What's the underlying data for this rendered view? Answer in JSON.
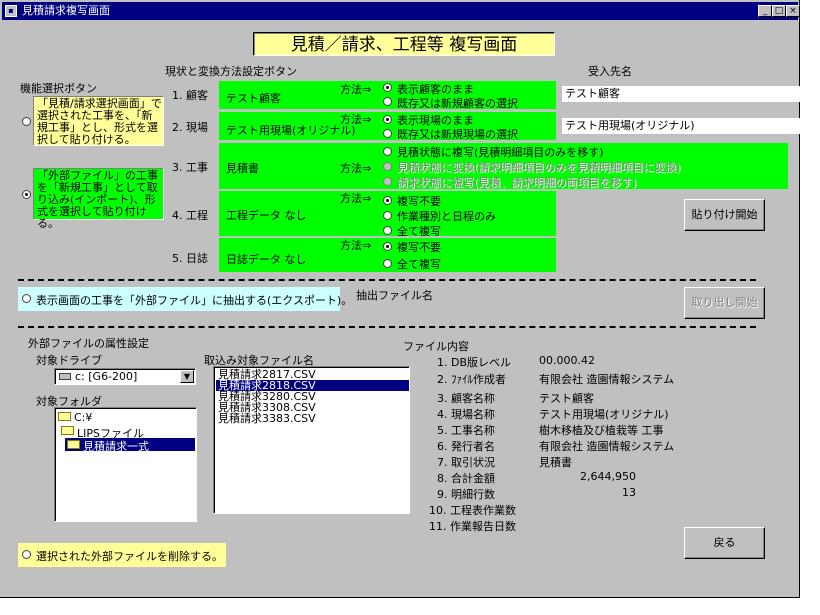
{
  "window": {
    "title": "見積請求複写画面"
  },
  "heading": "見積／請求、工程等 複写画面",
  "section_labels": {
    "function_select": "機能選択ボタン",
    "method_setting": "現状と変換方法設定ボタン",
    "receiver": "受入先名",
    "extract_file": "抽出ファイル名",
    "external_attrs": "外部ファイルの属性設定",
    "target_drive": "対象ドライブ",
    "target_folder": "対象フォルダ",
    "import_files": "取込み対象ファイル名",
    "file_content": "ファイル内容"
  },
  "function_options": [
    {
      "text": "「見積/請求選択画面」で選択された工事を、「新規工事」とし、形式を選択して貼り付ける。",
      "selected": false
    },
    {
      "text": "「外部ファイル」の工事を「新規工事」として取り込み(インポート)、形式を選択して貼り付ける。",
      "selected": true
    }
  ],
  "export_option": "表示画面の工事を「外部ファイル」に抽出する(エクスポート)。",
  "delete_option": "選択された外部ファイルを削除する。",
  "method_label": "方法⇒",
  "rows": [
    {
      "label": "1. 顧客",
      "current": "テスト顧客",
      "options": [
        {
          "text": "表示顧客のまま",
          "selected": true
        },
        {
          "text": "既存又は新規顧客の選択",
          "selected": false
        }
      ],
      "receiver": "テスト顧客"
    },
    {
      "label": "2. 現場",
      "current": "テスト用現場(オリジナル)",
      "options": [
        {
          "text": "表示現場のまま",
          "selected": true
        },
        {
          "text": "既存又は新規現場の選択",
          "selected": false
        }
      ],
      "receiver": "テスト用現場(オリジナル)"
    },
    {
      "label": "3. 工事",
      "current": "見積書",
      "options": [
        {
          "text": "見積状態に複写(見積明細項目のみを移す)",
          "selected": false
        },
        {
          "text": "見積状態に変換(請求明細項目のみを見積明細項目に変換)",
          "selected": false
        },
        {
          "text": "請求状態に複写(見積、請求明細の両項目を移す)",
          "selected": false
        }
      ]
    },
    {
      "label": "4. 工程",
      "current": "工程データ なし",
      "options": [
        {
          "text": "複写不要",
          "selected": true
        },
        {
          "text": "作業種別と日程のみ",
          "selected": false
        },
        {
          "text": "全て複写",
          "selected": false
        }
      ]
    },
    {
      "label": "5. 日誌",
      "current": "日誌データ なし",
      "options": [
        {
          "text": "複写不要",
          "selected": true
        },
        {
          "text": "全て複写",
          "selected": false
        }
      ]
    }
  ],
  "buttons": {
    "paste": "貼り付け開始",
    "extract": "取り出し開始",
    "back": "戻る"
  },
  "drive": {
    "value": "c: [G6-200]"
  },
  "folders": [
    "C:¥",
    "LIPSファイル",
    "見積請求一式"
  ],
  "files": [
    {
      "name": "見積請求2817.CSV",
      "selected": false
    },
    {
      "name": "見積請求2818.CSV",
      "selected": true
    },
    {
      "name": "見積請求3280.CSV",
      "selected": false
    },
    {
      "name": "見積請求3308.CSV",
      "selected": false
    },
    {
      "name": "見積請求3383.CSV",
      "selected": false
    }
  ],
  "file_info": [
    {
      "label": "1. DB版レベル",
      "value": "00.000.42"
    },
    {
      "label": "2. ﾌｧｲﾙ作成者",
      "value": "有限会社 造園情報システム"
    },
    {
      "label": "3. 顧客名称",
      "value": "テスト顧客"
    },
    {
      "label": "4. 現場名称",
      "value": "テスト用現場(オリジナル)"
    },
    {
      "label": "5. 工事名称",
      "value": "樹木移植及び植栽等 工事"
    },
    {
      "label": "6. 発行者名",
      "value": "有限会社 造園情報システム"
    },
    {
      "label": "7. 取引状況",
      "value": "見積書"
    },
    {
      "label": "8. 合計金額",
      "value": "2,644,950"
    },
    {
      "label": "9. 明細行数",
      "value": "13"
    },
    {
      "label": "10. 工程表作業数",
      "value": ""
    },
    {
      "label": "11. 作業報告日数",
      "value": ""
    }
  ],
  "icons": {
    "window": "window-icon",
    "drive": "drive-icon",
    "folder": "folder-icon",
    "dropdown": "chevron-down-icon"
  }
}
